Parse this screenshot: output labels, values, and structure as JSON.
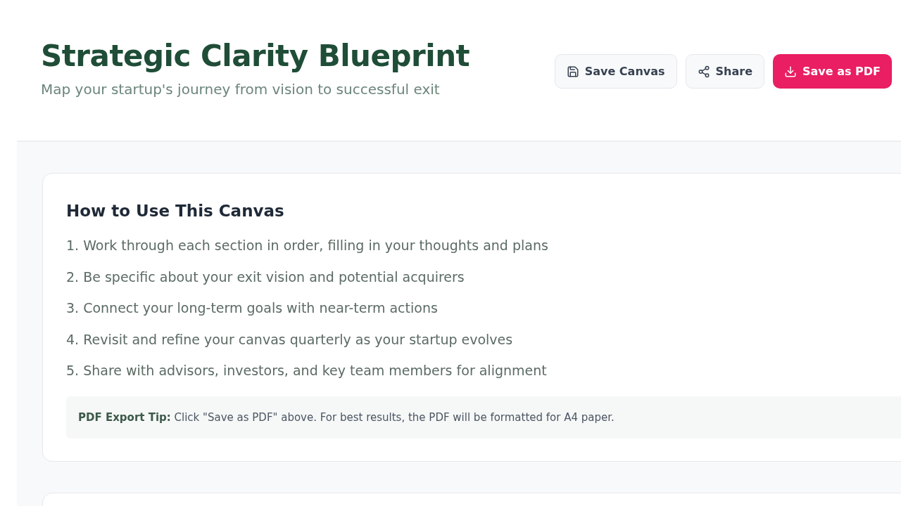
{
  "header": {
    "title": "Strategic Clarity Blueprint",
    "subtitle": "Map your startup's journey from vision to successful exit"
  },
  "actions": [
    {
      "kind": "save",
      "label": "Save Canvas",
      "primary": false
    },
    {
      "kind": "share",
      "label": "Share",
      "primary": false
    },
    {
      "kind": "download",
      "label": "Save as PDF",
      "primary": true
    }
  ],
  "instructions": {
    "title": "How to Use This Canvas",
    "steps": [
      "1. Work through each section in order, filling in your thoughts and plans",
      "2. Be specific about your exit vision and potential acquirers",
      "3. Connect your long-term goals with near-term actions",
      "4. Revisit and refine your canvas quarterly as your startup evolves",
      "5. Share with advisors, investors, and key team members for alignment"
    ],
    "tip": "**PDF Export Tip:** Click \"Save as PDF\" above. For best results, the PDF will be formatted for A4 paper."
  }
}
